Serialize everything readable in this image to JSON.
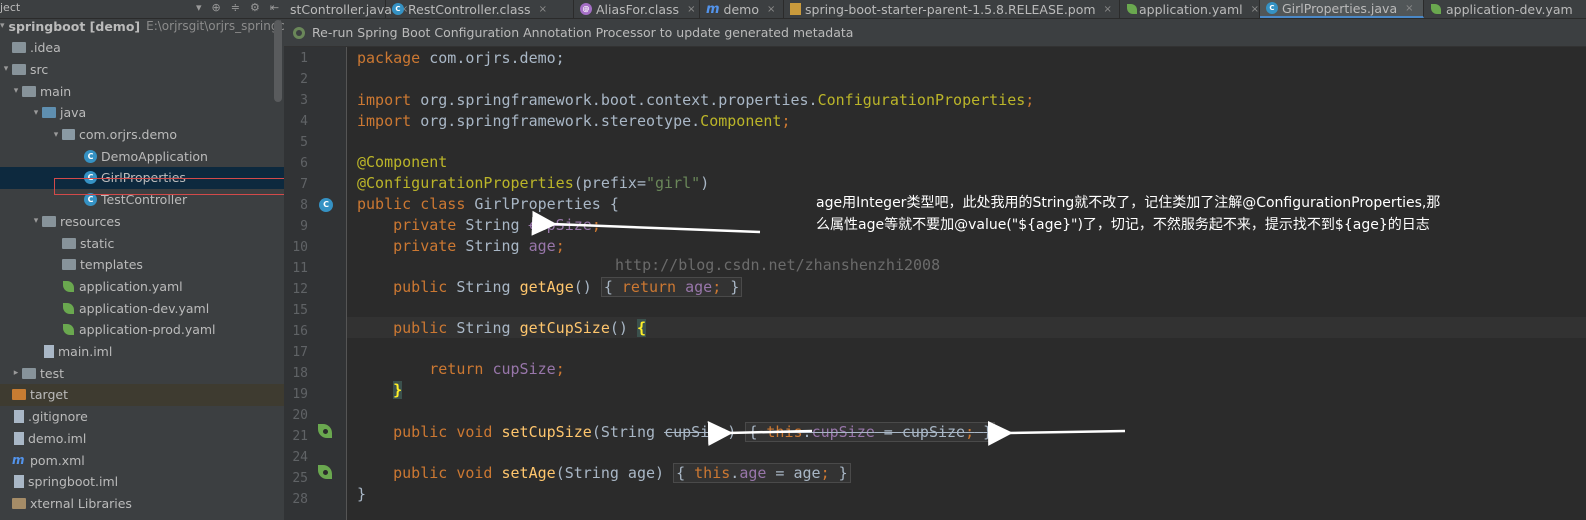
{
  "project_header": {
    "title": "ject"
  },
  "tree": [
    {
      "label": "springboot [demo]",
      "suffix": "E:\\orjrsgit\\orjrs_springboot",
      "icon": "folder"
    },
    {
      "label": ".idea",
      "icon": "folder"
    },
    {
      "label": "src",
      "icon": "folder"
    },
    {
      "label": "main",
      "icon": "folder"
    },
    {
      "label": "java",
      "icon": "folder-blue"
    },
    {
      "label": "com.orjrs.demo",
      "icon": "package"
    },
    {
      "label": "DemoApplication",
      "icon": "class"
    },
    {
      "label": "GirlProperties",
      "icon": "class"
    },
    {
      "label": "TestController",
      "icon": "class"
    },
    {
      "label": "resources",
      "icon": "folder"
    },
    {
      "label": "static",
      "icon": "folder"
    },
    {
      "label": "templates",
      "icon": "folder"
    },
    {
      "label": "application.yaml",
      "icon": "spring-leaf"
    },
    {
      "label": "application-dev.yaml",
      "icon": "spring-leaf"
    },
    {
      "label": "application-prod.yaml",
      "icon": "spring-leaf"
    },
    {
      "label": "main.iml",
      "icon": "file"
    },
    {
      "label": "test",
      "icon": "folder"
    },
    {
      "label": "target",
      "icon": "folder-orange"
    },
    {
      "label": ".gitignore",
      "icon": "file"
    },
    {
      "label": "demo.iml",
      "icon": "file"
    },
    {
      "label": "pom.xml",
      "icon": "maven"
    },
    {
      "label": "springboot.iml",
      "icon": "file"
    },
    {
      "label": "xternal Libraries",
      "icon": "library"
    }
  ],
  "tabs": [
    {
      "label": "stController.java",
      "icon": "class"
    },
    {
      "label": "RestController.class",
      "icon": "class"
    },
    {
      "label": "AliasFor.class",
      "icon": "class"
    },
    {
      "label": "demo",
      "icon": "maven"
    },
    {
      "label": "spring-boot-starter-parent-1.5.8.RELEASE.pom",
      "icon": "pom"
    },
    {
      "label": "application.yaml",
      "icon": "spring-leaf"
    },
    {
      "label": "GirlProperties.java",
      "icon": "class",
      "active": true
    },
    {
      "label": "application-dev.yam",
      "icon": "spring-leaf"
    }
  ],
  "notification": {
    "text": "Re-run Spring Boot Configuration Annotation Processor to update generated metadata"
  },
  "line_numbers": [
    "1",
    "2",
    "3",
    "4",
    "5",
    "6",
    "7",
    "8",
    "9",
    "10",
    "11",
    "12",
    "15",
    "16",
    "17",
    "18",
    "19",
    "20",
    "21",
    "24",
    "25",
    "28"
  ],
  "code": {
    "l1_kw": "package",
    "l1_rest": " com.orjrs.demo;",
    "l3_kw": "import",
    "l3_pkg": " org.springframework.boot.context.properties.",
    "l3_cls": "ConfigurationProperties",
    "l3_end": ";",
    "l4_kw": "import",
    "l4_pkg": " org.springframework.stereotype.",
    "l4_cls": "Component",
    "l4_end": ";",
    "l6_ann": "@Component",
    "l7_ann": "@ConfigurationProperties",
    "l7_open": "(prefix=",
    "l7_str": "\"girl\"",
    "l7_close": ")",
    "l8_kw": "public class",
    "l8_rest": " GirlProperties {",
    "l9_kw": "private",
    "l9_type": " String ",
    "l9_fld": "cupSize",
    "l9_end": ";",
    "l10_kw": "private",
    "l10_type": " String ",
    "l10_fld": "age",
    "l10_end": ";",
    "l12_kw": "public",
    "l12_type": " String ",
    "l12_mth": "getAge",
    "l12_par": "()",
    "l12_o": "{",
    "l12_ret": "return",
    "l12_fld": "age",
    "l12_sc": ";",
    "l12_c": "}",
    "l16_kw": "public",
    "l16_type": " String ",
    "l16_mth": "getCupSize",
    "l16_par": "() ",
    "l16_brace": "{",
    "l18_ret": "return",
    "l18_fld": "cupSize",
    "l18_end": ";",
    "l19_brace": "}",
    "l21_kw": "public void",
    "l21_mth": "setCupSize",
    "l21_par": "(String ",
    "l21_param": "cupSize)",
    "l21_o": "{",
    "l21_this": "this",
    "l21_dot": ".",
    "l21_fld": "cupSize",
    "l21_eq": " = ",
    "l21_val": "cupSize",
    "l21_sc": ";",
    "l21_c": "}",
    "l25_kw": "public void",
    "l25_mth": "setAge",
    "l25_par": "(String age)",
    "l25_o": "{",
    "l25_this": "this",
    "l25_dot": ".",
    "l25_fld": "age",
    "l25_eq": " = age",
    "l25_sc": ";",
    "l25_c": "}",
    "l28": "}"
  },
  "watermark": "http://blog.csdn.net/zhanshenzhi2008",
  "annotation_lines": [
    "age用Integer类型吧，此处我用的String就不改了，记住类加了注解@ConfigurationProperties,那",
    "么属性age等就不要加@value(\"${age}\")了，切记，不然服务起不来，提示找不到${age}的日志"
  ],
  "colors": {
    "keyword": "#cc7832",
    "annotation": "#bbb529",
    "string": "#6a8759",
    "field": "#9876aa",
    "method": "#ffc66d",
    "text": "#a9b7c6",
    "background": "#2b2b2b",
    "selection_box": "#d24a4a"
  }
}
